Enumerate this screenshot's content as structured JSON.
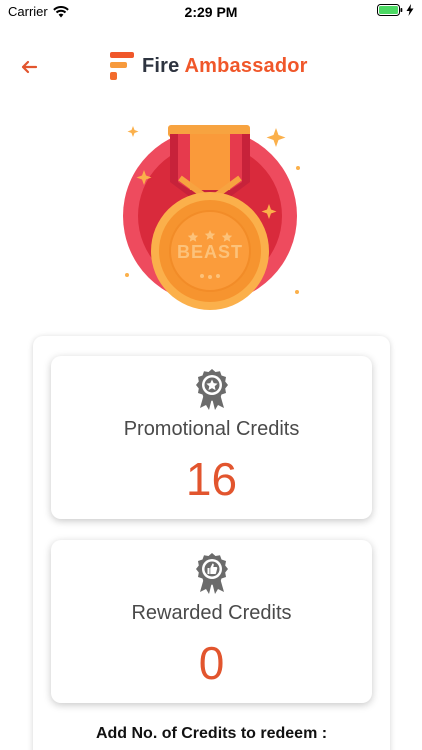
{
  "status_bar": {
    "carrier": "Carrier",
    "time": "2:29 PM",
    "wifi_icon": "wifi-icon",
    "battery_icon": "battery-icon"
  },
  "header": {
    "back_icon": "arrow-left-icon",
    "logo_icon": "fire-logo-icon",
    "title_part1": "Fire",
    "title_part2": "Ambassador"
  },
  "medal": {
    "text": "BEAST",
    "icon": "medal-icon"
  },
  "cards": {
    "promotional": {
      "icon": "award-badge-star-icon",
      "label": "Promotional Credits",
      "value": "16"
    },
    "rewarded": {
      "icon": "award-badge-thumbs-up-icon",
      "label": "Rewarded Credits",
      "value": "0"
    }
  },
  "redeem": {
    "label": "Add No. of Credits to redeem :"
  },
  "colors": {
    "accent": "#e2552e",
    "brand_orange": "#f0572a",
    "medal_ring": "#ee4b5e",
    "medal_gold": "#fa9a3a"
  }
}
